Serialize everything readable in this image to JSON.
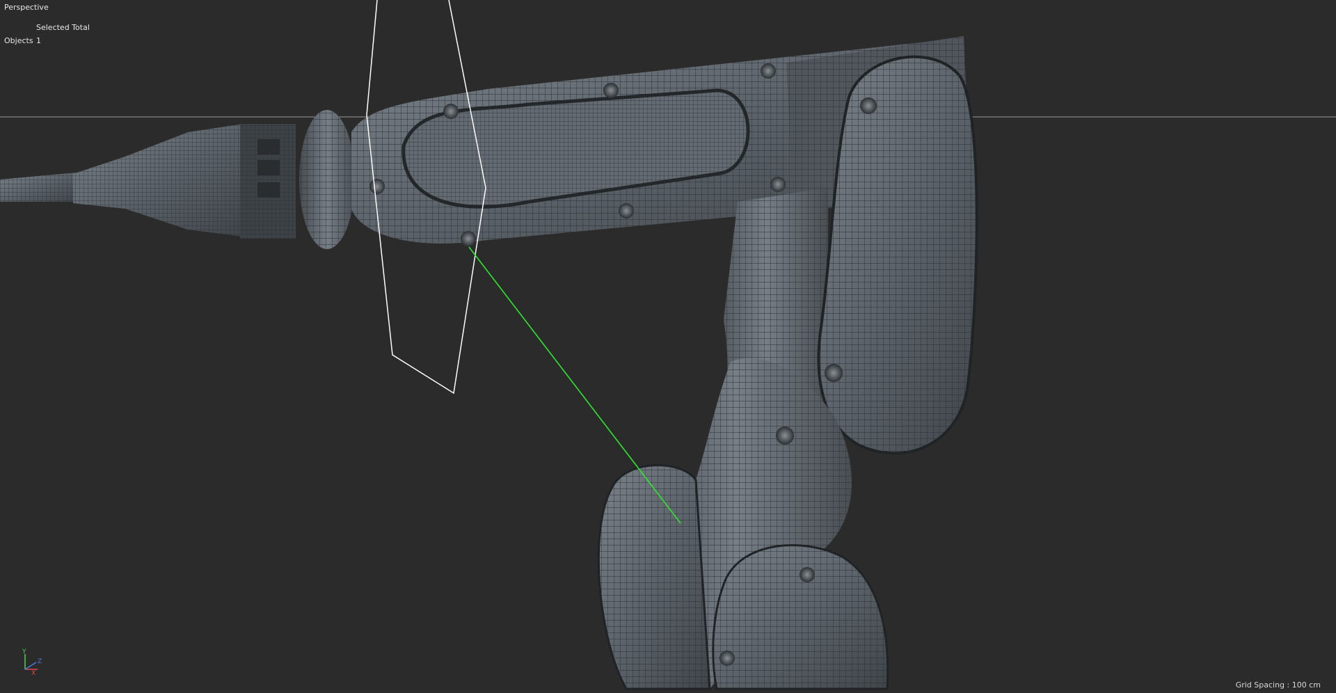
{
  "viewport": {
    "camera_name": "Perspective",
    "info_panel": {
      "column_header": "Selected Total",
      "row_label": "Objects",
      "row_value": "1"
    },
    "grid_spacing": "Grid Spacing : 100 cm",
    "axis_gizmo": {
      "y_label": "Y",
      "x_label": "X",
      "z_label": "Z",
      "y_color": "#4fd24f",
      "x_color": "#e04a4a",
      "z_color": "#4a78e0"
    }
  },
  "colors": {
    "background": "#2b2b2b",
    "horizon_line": "#9a9a9a",
    "camera_frustum": "#ffffff",
    "selection_line": "#2fe62f",
    "mesh_fill": "#5a6066",
    "mesh_wire": "#2a2e32"
  },
  "icons": {
    "axis_gizmo": "xyz-axis-icon"
  }
}
